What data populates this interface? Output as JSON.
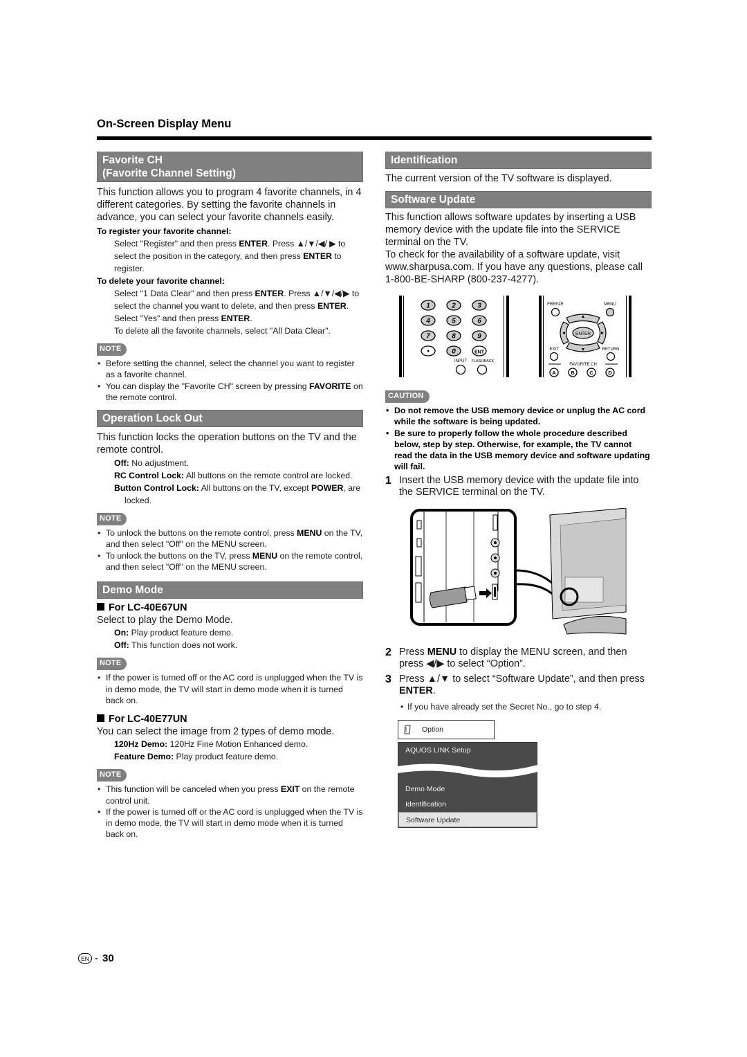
{
  "page": {
    "title": "On-Screen Display Menu",
    "page_number": "30",
    "language_badge": "EN",
    "separator": "-"
  },
  "favorite": {
    "heading_line1": "Favorite CH",
    "heading_line2": "(Favorite Channel Setting)",
    "intro": "This function allows you to program 4 favorite channels, in 4 different categories. By setting the favorite channels in advance, you can select your favorite channels easily.",
    "register_head": "To register your favorite channel:",
    "register_1": "Select \"Register\" and then press ",
    "register_2": "ENTER",
    "register_3": ". Press ▲/▼/◀/ ▶ to select the position in the category, and then press ",
    "register_4": "ENTER",
    "register_5": " to register.",
    "delete_head": "To delete your favorite channel:",
    "delete_1": "Select \"1 Data Clear\" and then press ",
    "delete_2": "ENTER",
    "delete_3": ". Press ▲/▼/◀/▶ to select the channel you want to delete, and then press ",
    "delete_4": "ENTER",
    "delete_5": ". Select \"Yes\" and then press ",
    "delete_6": "ENTER",
    "delete_7": ".",
    "delete_all": "To delete all the favorite channels, select \"All Data Clear\".",
    "note_label": "NOTE",
    "note_1": "Before setting the channel, select the channel you want to register as a favorite channel.",
    "note_2a": "You can display the \"Favorite CH\" screen by pressing ",
    "note_2b": "FAVORITE",
    "note_2c": " on the remote control."
  },
  "lock": {
    "heading": "Operation Lock Out",
    "intro": "This function locks the operation buttons on the TV and the remote control.",
    "off_label": "Off:",
    "off_text": " No adjustment.",
    "rc_label": "RC Control Lock:",
    "rc_text": " All buttons on the remote control are locked.",
    "btn_label": "Button Control Lock:",
    "btn_text_1": " All buttons on the TV, except ",
    "btn_text_2": "POWER",
    "btn_text_3": ", are locked.",
    "note_label": "NOTE",
    "note_1a": "To unlock the buttons on the remote control, press ",
    "note_1b": "MENU",
    "note_1c": " on the TV, and then select \"Off\" on the MENU screen.",
    "note_2a": "To unlock the buttons on the TV, press ",
    "note_2b": "MENU",
    "note_2c": " on the remote control, and then select \"Off\" on the MENU screen."
  },
  "demo": {
    "heading": "Demo Mode",
    "model1": "For LC-40E67UN",
    "model1_intro": "Select to play the Demo Mode.",
    "on_label": "On:",
    "on_text": " Play product feature demo.",
    "off_label": "Off:",
    "off_text": " This function does not work.",
    "note_label": "NOTE",
    "note_1": "If the power is turned off or the AC cord is unplugged when the TV is in demo mode, the TV will start in demo mode when it is turned back on.",
    "model2": "For LC-40E77UN",
    "model2_intro": "You can select the image from 2 types of demo mode.",
    "hz_label": "120Hz Demo:",
    "hz_text": " 120Hz Fine Motion Enhanced demo.",
    "feature_label": "Feature Demo:",
    "feature_text": " Play product feature demo.",
    "note2_label": "NOTE",
    "note2_1a": "This function will be canceled when you press ",
    "note2_1b": "EXIT",
    "note2_1c": " on the remote control unit.",
    "note2_2": "If the power is turned off or the AC cord is unplugged when the TV is in demo mode, the TV will start in demo mode when it is turned back on."
  },
  "identification": {
    "heading": "Identification",
    "text": "The current version of the TV software is displayed."
  },
  "software": {
    "heading": "Software Update",
    "intro_1": "This function allows software updates by inserting a USB memory device with the update file into the SERVICE terminal on the TV.",
    "intro_2": "To check for the availability of a software update, visit www.sharpusa.com. If you have any questions, please call 1-800-BE-SHARP (800-237-4277).",
    "caution_label": "CAUTION",
    "caution_1": "Do not remove the USB memory device or unplug the AC cord while the software is being updated.",
    "caution_2": "Be sure to properly follow the whole procedure described below, step by step. Otherwise, for example, the TV cannot read the data in the USB memory device and software updating will fail.",
    "step1_num": "1",
    "step1": "Insert the USB memory device with the update file into the SERVICE terminal on the TV.",
    "step2_num": "2",
    "step2a": "Press ",
    "step2b": "MENU",
    "step2c": " to display the MENU screen, and then press ◀/▶ to select “Option”.",
    "step3_num": "3",
    "step3a": "Press ▲/▼ to select “Software Update”, and then press ",
    "step3b": "ENTER",
    "step3c": ".",
    "step3_sub": "If you have already set the Secret No., go to step 4."
  },
  "remote": {
    "numpad": [
      "1",
      "2",
      "3",
      "4",
      "5",
      "6",
      "7",
      "8",
      "9",
      "•",
      "0",
      "ENT"
    ],
    "input_label": "INPUT",
    "flashback_label": "FLASHBACK",
    "freeze_label": "FREEZE",
    "menu_label": "MENU",
    "enter_label": "ENTER",
    "exit_label": "EXIT",
    "return_label": "RETURN",
    "favorite_label": "FAVORITE CH",
    "fav_buttons": [
      "A",
      "B",
      "C",
      "D"
    ]
  },
  "osd_menu": {
    "title": "Option",
    "items": [
      "AQUOS LINK Setup",
      "Demo Mode",
      "Identification",
      "Software Update"
    ],
    "selected": "Software Update"
  }
}
